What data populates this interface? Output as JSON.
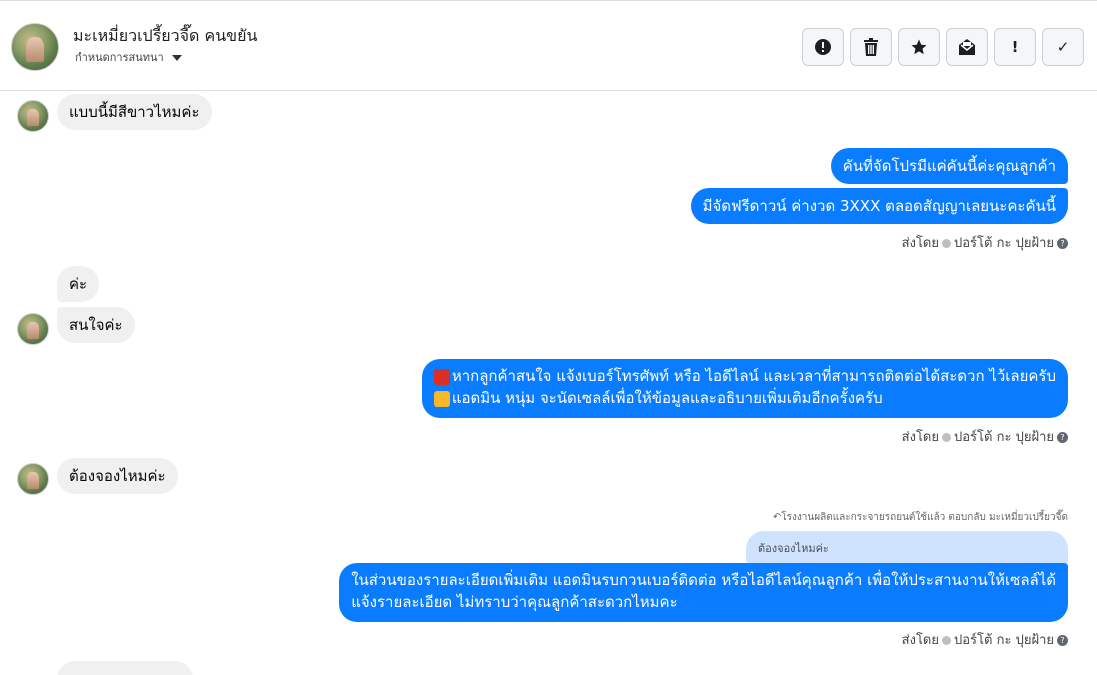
{
  "header": {
    "name": "มะเหมี่ยวเปรี้ยวจี๊ด คนขยัน",
    "subtitle": "กำหนดการสนทนา",
    "actions": [
      {
        "icon": "alert-circle-icon",
        "glyph": "!"
      },
      {
        "icon": "trash-icon",
        "glyph": "🗑"
      },
      {
        "icon": "star-icon",
        "glyph": "★"
      },
      {
        "icon": "mail-open-icon",
        "glyph": "✉"
      },
      {
        "icon": "exclamation-icon",
        "glyph": "!"
      },
      {
        "icon": "checkmark-icon",
        "glyph": "✓"
      }
    ]
  },
  "messages": {
    "in1": "แบบนี้มีสีขาวไหมค่ะ",
    "out1": "คันที่จัดโปรมีแค่คันนี้ค่ะคุณลูกค้า",
    "out2": "มีจัดฟรีดาวน์ ค่างวด 3XXX ตลอดสัญญาเลยนะคะคันนี้",
    "in2": "ค่ะ",
    "in3": "สนใจค่ะ",
    "out3_line1": "หากลูกค้าสนใจ แจ้งเบอร์โทรศัพท์ หรือ ไอดีไลน์ และเวลาที่สามารถติดต่อได้สะดวก ไว้เลยครับ",
    "out3_line2": "แอดมิน หนุ่ม จะนัดเซลล์เพื่อให้ข้อมูลและอธิบายเพิ่มเติมอีกครั้งครับ",
    "in4": "ต้องจองไหมค่ะ",
    "reply_note": "โรงงานผลิตและกระจายรถยนต์ใช้แล้ว ตอบกลับ มะเหมี่ยวเปรี้ยวจี๊ด",
    "reply_quote": "ต้องจองไหมค่ะ",
    "out4_line1": "ในส่วนของรายละเอียดเพิ่มเติม แอดมินรบกวนเบอร์ติดต่อ หรือไอดีไลน์คุณลูกค้า เพื่อให้ประสานงานให้เซลล์ได้",
    "out4_line2": "แจ้งรายละเอียด ไม่ทราบว่าคุณลูกค้าสะดวกไหมคะ"
  },
  "sent_by": {
    "prefix": "ส่งโดย",
    "name": "ปอร์โต้ กะ ปุยฝ้าย",
    "help": "?"
  }
}
